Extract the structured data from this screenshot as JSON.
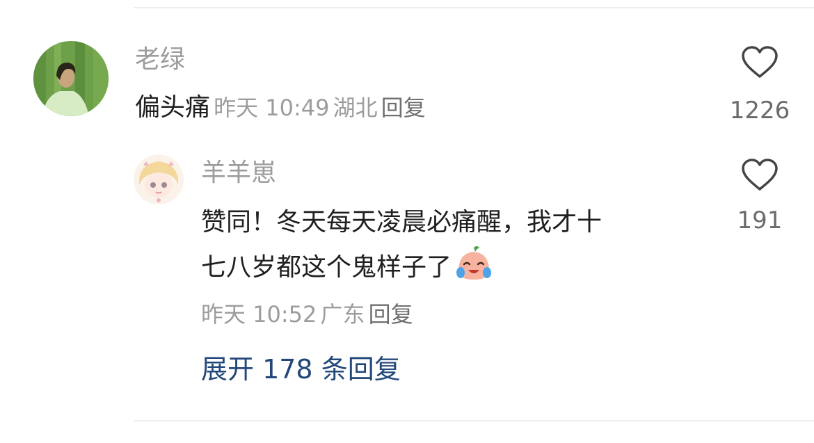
{
  "comment": {
    "username": "老绿",
    "text": "偏头痛",
    "time": "昨天 10:49",
    "location": "湖北",
    "reply_label": "回复",
    "like_count": "1226",
    "avatar_icon": "green-portrait-avatar"
  },
  "reply": {
    "username": "羊羊崽",
    "text_line1": "赞同！冬天每天凌晨必痛醒，我才十",
    "text_line2": "七八岁都这个鬼样子了",
    "emoji_icon": "crying-face-emoji",
    "time": "昨天 10:52",
    "location": "广东",
    "reply_label": "回复",
    "like_count": "191",
    "avatar_icon": "anime-girl-avatar"
  },
  "expand": {
    "label": "展开 178 条回复"
  },
  "colors": {
    "link": "#22487a",
    "meta": "#9c9c9c",
    "text": "#1f1f1f"
  }
}
